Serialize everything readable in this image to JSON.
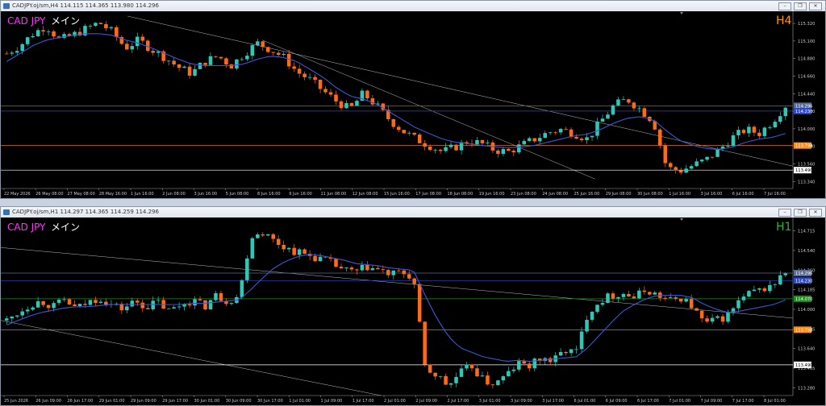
{
  "colors": {
    "bull": "#2fc7b5",
    "bear": "#ff6a1a",
    "ma": "#3d56d6",
    "symbol": "#ff33ff",
    "price_bg": "#5a6d90",
    "orange_line": "#ff8c1a",
    "green_line": "#1e8f1e"
  },
  "windows": [
    {
      "title": "CADJPY.oj/sm,H4  114.115 114.365 113.980 114.296",
      "symbol": "CAD JPY",
      "mode": "メイン",
      "timeframe": "H4",
      "tf_color": "#ff9900",
      "controls": [
        "minimize-icon",
        "restore-icon",
        "close-icon"
      ],
      "y_ticks": [
        "115.320",
        "115.100",
        "114.880",
        "114.660",
        "114.440",
        "114.220",
        "114.000",
        "113.780",
        "113.560",
        "113.340"
      ],
      "y_min": 113.26,
      "y_max": 115.46,
      "x_labels": [
        "22 May 2026",
        "26 May 08:00",
        "27 May 08:00",
        "28 May 16:00",
        "1 Jun 16:00",
        "2 Jun 08:00",
        "3 Jun 16:00",
        "5 Jun 08:00",
        "8 Jun 16:00",
        "9 Jun 16:00",
        "11 Jun 08:00",
        "12 Jun 08:00",
        "15 Jun 16:00",
        "17 Jun 08:00",
        "18 Jun 08:00",
        "19 Jun 16:00",
        "23 Jun 08:00",
        "24 Jun 08:00",
        "25 Jun 16:00",
        "29 Jun 08:00",
        "30 Jun 08:00",
        "1 Jul 16:00",
        "3 Jul 16:00",
        "6 Jul 16:00",
        "7 Jul 16:00"
      ],
      "hlines": [
        {
          "price": 114.296,
          "label": "114.296",
          "color": "#5a6d90"
        },
        {
          "price": 114.23,
          "label": "114.230",
          "color": "#2c48c8"
        },
        {
          "price": 113.798,
          "label": "113.798",
          "color": "#ff8c1a"
        },
        {
          "price": 113.49,
          "label": "113.490",
          "color": "#ffffff"
        }
      ],
      "trendlines": [
        {
          "x1": 0.16,
          "p1": 115.42,
          "x2": 1.0,
          "p2": 113.54
        },
        {
          "x1": 0.33,
          "p1": 115.12,
          "x2": 0.75,
          "p2": 113.38
        }
      ],
      "seed": 7,
      "path": [
        114.95,
        115.05,
        115.2,
        115.3,
        115.12,
        115.18,
        115.26,
        115.34,
        115.22,
        115.02,
        115.12,
        115.0,
        114.9,
        114.78,
        114.7,
        114.85,
        114.92,
        114.8,
        114.95,
        115.08,
        115.0,
        114.9,
        114.72,
        114.62,
        114.48,
        114.35,
        114.25,
        114.45,
        114.3,
        114.12,
        113.98,
        113.88,
        113.8,
        113.72,
        113.78,
        113.86,
        113.82,
        113.74,
        113.72,
        113.8,
        113.88,
        113.96,
        114.0,
        113.95,
        113.88,
        114.1,
        114.3,
        114.38,
        114.25,
        114.1,
        113.52,
        113.48,
        113.55,
        113.62,
        113.75,
        113.9,
        114.0,
        113.95,
        114.1,
        114.3
      ],
      "ma_path": [
        114.85,
        114.95,
        115.05,
        115.12,
        115.15,
        115.18,
        115.2,
        115.2,
        115.18,
        115.12,
        115.08,
        115.02,
        114.95,
        114.88,
        114.82,
        114.8,
        114.8,
        114.8,
        114.82,
        114.88,
        114.92,
        114.9,
        114.85,
        114.75,
        114.65,
        114.52,
        114.42,
        114.38,
        114.32,
        114.22,
        114.12,
        114.02,
        113.95,
        113.88,
        113.84,
        113.82,
        113.8,
        113.78,
        113.77,
        113.78,
        113.8,
        113.84,
        113.88,
        113.92,
        113.94,
        114.0,
        114.08,
        114.14,
        114.16,
        114.12,
        113.98,
        113.86,
        113.8,
        113.76,
        113.75,
        113.78,
        113.84,
        113.88,
        113.9,
        113.95
      ]
    },
    {
      "title": "CADJPY.oj/sm,H1  114.297 114.365 114.259 114.296",
      "symbol": "CAD JPY",
      "mode": "メイン",
      "timeframe": "H1",
      "tf_color": "#2fae3a",
      "controls": [
        "minimize-icon",
        "restore-icon",
        "close-icon"
      ],
      "y_ticks": [
        "114.715",
        "114.540",
        "114.360",
        "114.185",
        "114.000",
        "113.825",
        "113.640",
        "113.465",
        "113.280"
      ],
      "y_min": 113.22,
      "y_max": 114.77,
      "x_labels": [
        "25 Jun 2026",
        "26 Jun 09:00",
        "26 Jun 17:00",
        "29 Jun 01:00",
        "29 Jun 09:00",
        "29 Jun 17:00",
        "30 Jun 01:00",
        "30 Jun 09:00",
        "30 Jun 17:00",
        "1 Jul 01:00",
        "1 Jul 09:00",
        "1 Jul 17:00",
        "2 Jul 01:00",
        "2 Jul 09:00",
        "2 Jul 17:00",
        "3 Jul 01:00",
        "3 Jul 09:00",
        "3 Jul 17:00",
        "6 Jul 01:00",
        "6 Jul 09:00",
        "6 Jul 17:00",
        "7 Jul 01:00",
        "7 Jul 09:00",
        "7 Jul 17:00",
        "8 Jul 01:00"
      ],
      "hlines": [
        {
          "price": 114.296,
          "label": "114.296",
          "color": "#5a6d90"
        },
        {
          "price": 114.23,
          "label": "114.230",
          "color": "#2c48c8"
        },
        {
          "price": 114.07,
          "label": "114.070",
          "color": "#1e8f1e"
        },
        {
          "price": 113.798,
          "label": "113.798",
          "color": "#ff8c1a"
        },
        {
          "price": 113.49,
          "label": "113.490",
          "color": "#ffffff"
        }
      ],
      "trendlines": [
        {
          "x1": 0.0,
          "p1": 114.52,
          "x2": 1.0,
          "p2": 113.9
        },
        {
          "x1": 0.0,
          "p1": 113.88,
          "x2": 0.48,
          "p2": 113.22
        }
      ],
      "seed": 13,
      "path": [
        113.88,
        113.95,
        114.02,
        114.05,
        114.0,
        114.06,
        113.98,
        114.04,
        114.08,
        114.02,
        113.98,
        114.05,
        114.0,
        114.04,
        113.96,
        114.02,
        114.06,
        114.0,
        114.1,
        114.05,
        114.1,
        114.62,
        114.66,
        114.58,
        114.52,
        114.48,
        114.45,
        114.42,
        114.38,
        114.32,
        114.3,
        114.35,
        114.32,
        114.28,
        114.3,
        114.25,
        113.45,
        113.4,
        113.3,
        113.42,
        113.48,
        113.35,
        113.32,
        113.4,
        113.5,
        113.48,
        113.55,
        113.52,
        113.62,
        113.6,
        113.95,
        114.05,
        114.1,
        114.12,
        114.08,
        114.15,
        114.1,
        114.05,
        114.08,
        114.0,
        113.85,
        113.88,
        113.92,
        114.05,
        114.12,
        114.15,
        114.2,
        114.3
      ],
      "ma_path": [
        113.84,
        113.88,
        113.92,
        113.95,
        113.97,
        113.99,
        114.0,
        114.0,
        114.01,
        114.02,
        114.02,
        114.02,
        114.02,
        114.02,
        114.02,
        114.02,
        114.03,
        114.03,
        114.04,
        114.05,
        114.06,
        114.15,
        114.25,
        114.34,
        114.4,
        114.44,
        114.46,
        114.45,
        114.43,
        114.41,
        114.38,
        114.37,
        114.36,
        114.34,
        114.33,
        114.32,
        114.1,
        113.9,
        113.74,
        113.64,
        113.6,
        113.56,
        113.54,
        113.52,
        113.53,
        113.52,
        113.53,
        113.54,
        113.55,
        113.56,
        113.64,
        113.75,
        113.86,
        113.96,
        114.02,
        114.07,
        114.1,
        114.1,
        114.1,
        114.08,
        114.02,
        113.98,
        113.95,
        113.96,
        113.98,
        114.0,
        114.02,
        114.06
      ]
    }
  ]
}
